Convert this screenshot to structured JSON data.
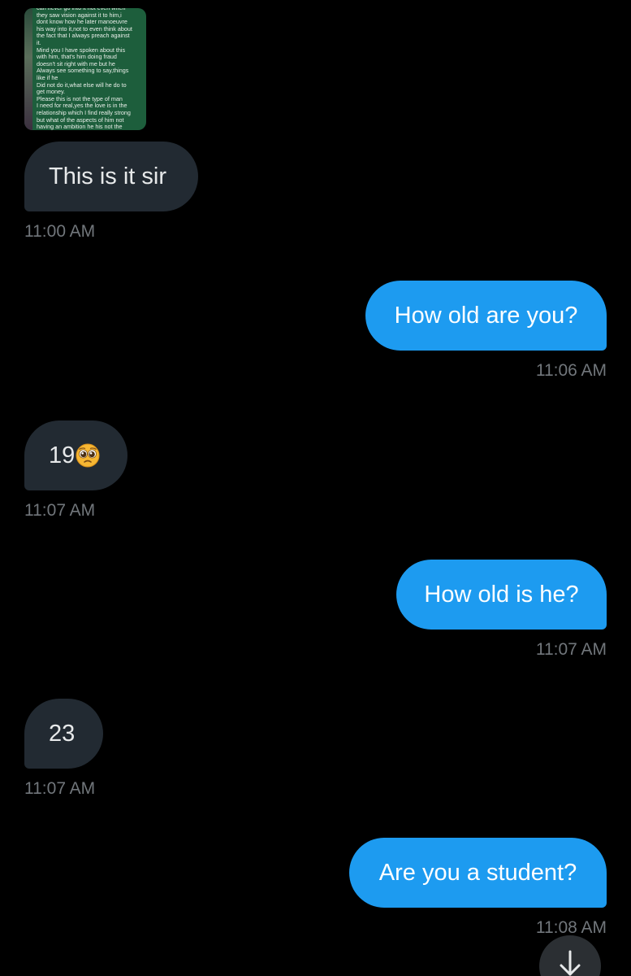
{
  "conversation": {
    "attachment": {
      "icon": "screenshot-thumbnail",
      "text": "can never go into it not even when\nthey saw vision against it to him,i\ndont know how he later manoeuvre\nhis way into it,not to even think about\nthe fact that I always preach against\nit.\nMind you I have  spoken about this\nwith him, that's him doing fraud\ndoesn't sit right with me but he\nAlways see something to say,things\nlike if he\nDid not do it,what else will he do to\nget money.\nPlease this is not the type of man\nI need for real,yes the love is in the\nrelationship which I find really strong\nbut what of the aspects of him not\nhaving an ambition  he his not the"
    },
    "messages": [
      {
        "direction": "incoming",
        "text": "This is it sir",
        "time": "11:00 AM"
      },
      {
        "direction": "outgoing",
        "text": "How old are you?",
        "time": "11:06 AM"
      },
      {
        "direction": "incoming",
        "text": "19",
        "emoji": "pleading-face-emoji",
        "time": "11:07 AM"
      },
      {
        "direction": "outgoing",
        "text": "How old is he?",
        "time": "11:07 AM"
      },
      {
        "direction": "incoming",
        "text": "23",
        "time": "11:07 AM"
      },
      {
        "direction": "outgoing",
        "text": "Are you a student?",
        "time": "11:08 AM"
      }
    ],
    "scroll_button": {
      "icon": "arrow-down-icon"
    }
  },
  "colors": {
    "background": "#000000",
    "incoming_bubble": "#222a32",
    "outgoing_bubble": "#1d9bf0",
    "timestamp": "#71767b",
    "scroll_button": "#2b2f33"
  }
}
